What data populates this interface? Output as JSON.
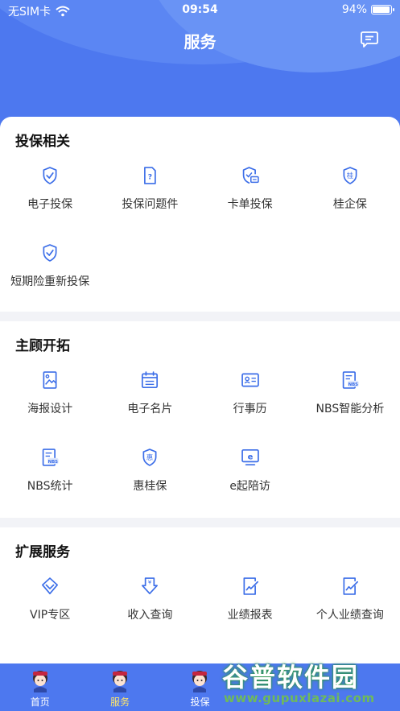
{
  "status_bar": {
    "carrier": "无SIM卡",
    "time": "09:54",
    "battery": "94%",
    "battery_level": 0.94
  },
  "navbar": {
    "title": "服务",
    "message_icon": "message-icon"
  },
  "sections": [
    {
      "title": "投保相关",
      "items": [
        {
          "label": "电子投保",
          "icon": "shield-check-icon"
        },
        {
          "label": "投保问题件",
          "icon": "question-document-icon"
        },
        {
          "label": "卡单投保",
          "icon": "shield-card-icon"
        },
        {
          "label": "桂企保",
          "icon": "gui-shield-icon"
        },
        {
          "label": "短期险重新投保",
          "icon": "shield-check-icon"
        }
      ]
    },
    {
      "title": "主顾开拓",
      "items": [
        {
          "label": "海报设计",
          "icon": "poster-icon"
        },
        {
          "label": "电子名片",
          "icon": "calendar-card-icon"
        },
        {
          "label": "行事历",
          "icon": "id-card-icon"
        },
        {
          "label": "NBS智能分析",
          "icon": "nbs-document-icon"
        },
        {
          "label": "NBS统计",
          "icon": "nbs-document-icon"
        },
        {
          "label": "惠桂保",
          "icon": "hui-shield-icon"
        },
        {
          "label": "e起陪访",
          "icon": "e-screen-icon"
        }
      ]
    },
    {
      "title": "扩展服务",
      "items": [
        {
          "label": "VIP专区",
          "icon": "vip-diamond-icon"
        },
        {
          "label": "收入查询",
          "icon": "income-icon"
        },
        {
          "label": "业绩报表",
          "icon": "report-icon"
        },
        {
          "label": "个人业绩查询",
          "icon": "report-icon"
        }
      ]
    }
  ],
  "tabbar": [
    {
      "label": "首页",
      "icon": "avatar-icon",
      "active": false
    },
    {
      "label": "服务",
      "icon": "avatar-icon",
      "active": true
    },
    {
      "label": "投保",
      "icon": "avatar-icon",
      "active": false
    }
  ],
  "watermark": {
    "title": "谷普软件园",
    "url": "www.gupuxlazai.com"
  },
  "colors": {
    "primary": "#4d78ef",
    "active_tab": "#ffe66b",
    "icon_blue": "#3c6ee8"
  }
}
